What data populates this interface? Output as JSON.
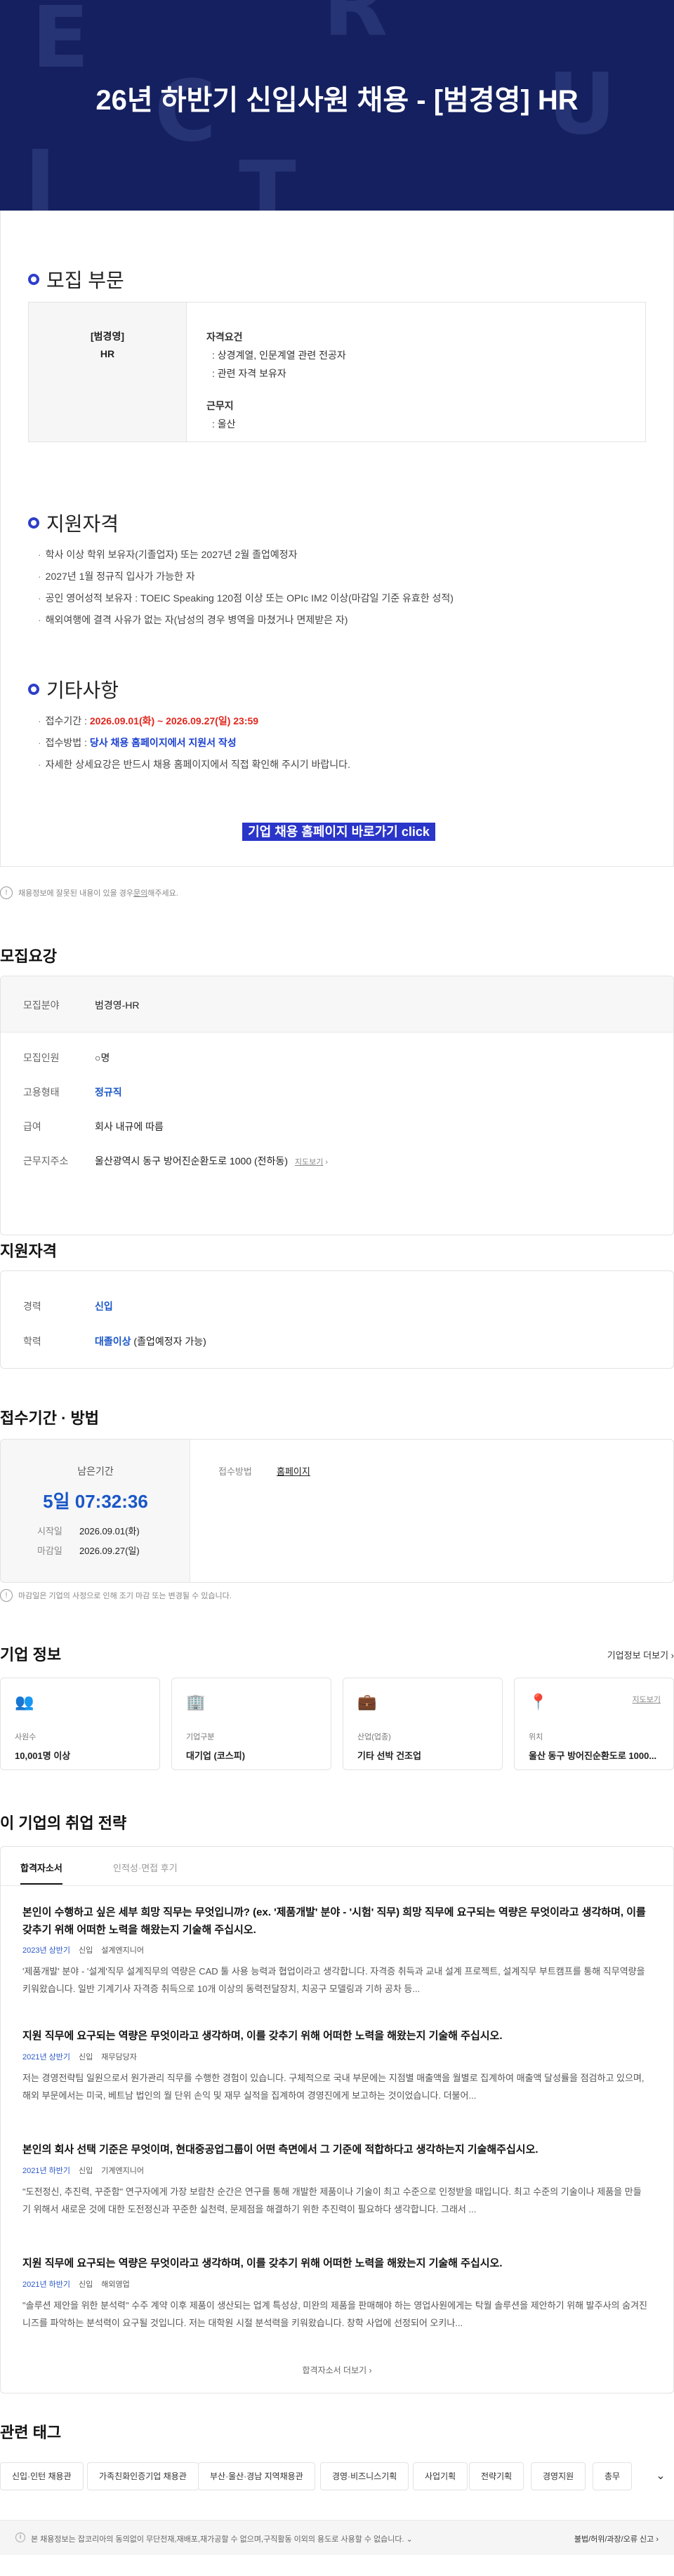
{
  "banner": {
    "title": "26년 하반기 신입사원 채용 - [범경영] HR",
    "deco_letters": [
      "E",
      "R",
      "C",
      "U",
      "I",
      "T"
    ]
  },
  "recruit_part": {
    "title": "모집 부문",
    "left": [
      "[범경영]",
      "HR"
    ],
    "req_title": "자격요건",
    "reqs": [
      "상경계열, 인문계열 관련 전공자",
      "관련 자격 보유자"
    ],
    "loc_title": "근무지",
    "locs": [
      "울산"
    ]
  },
  "qualification": {
    "title": "지원자격",
    "items": [
      "학사 이상 학위 보유자(기졸업자) 또는 2027년 2월 졸업예정자",
      "2027년 1월 정규직 입사가 가능한 자",
      "공인 영어성적 보유자 : TOEIC Speaking 120점 이상 또는 OPIc IM2 이상(마감일 기준 유효한 성적)",
      "해외여행에 결격 사유가 없는 자(남성의 경우 병역을 마쳤거나 면제받은 자)"
    ]
  },
  "etc": {
    "title": "기타사항",
    "period_label": "접수기간 : ",
    "period_value": "2026.09.01(화) ~ 2026.09.27(일) 23:59",
    "method_label": "접수방법 : ",
    "method_value": "당사 채용 홈페이지에서 지원서 작성",
    "detail": "자세한 상세요강은 반드시 채용 홈페이지에서 직접 확인해 주시기 바랍니다."
  },
  "apply_button": "기업 채용 홈페이지 바로가기 click",
  "notice_note": "채용정보에 잘못된 내용이 있을 경우 ",
  "notice_link": "문의",
  "notice_tail": "해주세요.",
  "summary": {
    "title": "모집요강",
    "field_label": "모집분야",
    "field_value": "범경영-HR",
    "count_label": "모집인원",
    "count_value": "○명",
    "type_label": "고용형태",
    "type_value": "정규직",
    "pay_label": "급여",
    "pay_value": "회사 내규에 따름",
    "addr_label": "근무지주소",
    "addr_value": "울산광역시 동구 방어진순환도로 1000 (전하동)",
    "map_link": "지도보기"
  },
  "qual_summary": {
    "title": "지원자격",
    "career_label": "경력",
    "career_value": "신입",
    "edu_label": "학력",
    "edu_value_bold": "대졸이상",
    "edu_value_rest": " (졸업예정자 가능)"
  },
  "period": {
    "title": "접수기간 · 방법",
    "remain_label": "남은기간",
    "remain_value": "5일 07:32:36",
    "start_label": "시작일",
    "start_value": "2026.09.01(화)",
    "end_label": "마감일",
    "end_value": "2026.09.27(일)",
    "method_label": "접수방법",
    "method_value": "홈페이지",
    "note": "마감일은 기업의 사정으로 인해 조기 마감 또는 변경될 수 있습니다."
  },
  "company": {
    "title": "기업 정보",
    "more": "기업정보 더보기",
    "cards": [
      {
        "icon": "people-icon",
        "label": "사원수",
        "value": "10,001명 이상"
      },
      {
        "icon": "building-icon",
        "label": "기업구분",
        "value": "대기업 (코스피)"
      },
      {
        "icon": "briefcase-icon",
        "label": "산업(업종)",
        "value": "기타 선박 건조업"
      },
      {
        "icon": "location-pin-icon",
        "label": "위치",
        "value": "울산 동구 방어진순환도로 1000...",
        "link": "지도보기"
      }
    ]
  },
  "strategy": {
    "title": "이 기업의 취업 전략",
    "tabs": [
      "합격자소서",
      "인적성·면접 후기"
    ],
    "items": [
      {
        "q": "본인이 수행하고 싶은 세부 희망 직무는 무엇입니까? (ex. '제품개발' 분야 - '시험' 직무) 희망 직무에 요구되는 역량은 무엇이라고 생각하며, 이를 갖추기 위해 어떠한 노력을 해왔는지 기술해 주십시오.",
        "year": "2023년 상반기",
        "kind": "신입",
        "job": "설계엔지니어",
        "body": "'제품개발' 분야 - '설계'직무 설계직무의 역량은 CAD 툴 사용 능력과 협업이라고 생각합니다. 자격증 취득과 교내 설계 프로젝트, 설계직무 부트캠프를 통해 직무역량을 키워왔습니다. 일반 기계기사 자격증 취득으로 10개 이상의 동력전달장치, 치공구 모델링과 기하 공차 등..."
      },
      {
        "q": "지원 직무에 요구되는 역량은 무엇이라고 생각하며, 이를 갖추기 위해 어떠한 노력을 해왔는지 기술해 주십시오.",
        "year": "2021년 상반기",
        "kind": "신입",
        "job": "재무담당자",
        "body": "저는 경영전략팀 일원으로서 원가관리 직무를 수행한 경험이 있습니다. 구체적으로 국내 부문에는 지점별 매출액을 월별로 집계하여 매출액 달성률을 점검하고 있으며, 해외 부문에서는 미국, 베트남 법인의 월 단위 손익 및 재무 실적을 집계하여 경영진에게 보고하는 것이었습니다. 더불어..."
      },
      {
        "q": "본인의 회사 선택 기준은 무엇이며, 현대중공업그룹이 어떤 측면에서 그 기준에 적합하다고 생각하는지 기술해주십시오.",
        "year": "2021년 하반기",
        "kind": "신입",
        "job": "기계엔지니어",
        "body": "\"도전정신, 추진력, 꾸준함\" 연구자에게 가장 보람찬 순간은 연구를 통해 개발한 제품이나 기술이 최고 수준으로 인정받을 때입니다. 최고 수준의 기술이나 제품을 만들기 위해서 새로운 것에 대한 도전정신과 꾸준한 실천력, 문제점을 해결하기 위한 추진력이 필요하다 생각합니다. 그래서 ..."
      },
      {
        "q": "지원 직무에 요구되는 역량은 무엇이라고 생각하며, 이를 갖추기 위해 어떠한 노력을 해왔는지 기술해 주십시오.",
        "year": "2021년 하반기",
        "kind": "신입",
        "job": "해외영업",
        "body": "\"솔루션 제안을 위한 분석력\" 수주 계약 이후 제품이 생산되는 업계 특성상, 미완의 제품을 판매해야 하는 영업사원에게는 탁월 솔루션을 제안하기 위해 발주사의 숨겨진 니즈를 파악하는 분석력이 요구될 것입니다. 저는 대학원 시절 분석력을 키워왔습니다. 창학 사업에 선정되어 오키나..."
      }
    ],
    "more": "합격자소서 더보기"
  },
  "tags": {
    "title": "관련 태그",
    "items": [
      "신입·인턴 채용관",
      "가족친화인증기업 채용관",
      "부산·울산·경남 지역채용관",
      "경영·비즈니스기획",
      "사업기획",
      "전략기획",
      "경영지원",
      "총무"
    ]
  },
  "footer": {
    "text": "본 채용정보는 잡코리아의 동의없이 무단전재,재배포,재가공할 수 없으며,구직활동 이외의 용도로 사용할 수 없습니다.",
    "report": "불법/허위/과장/오류 신고"
  }
}
